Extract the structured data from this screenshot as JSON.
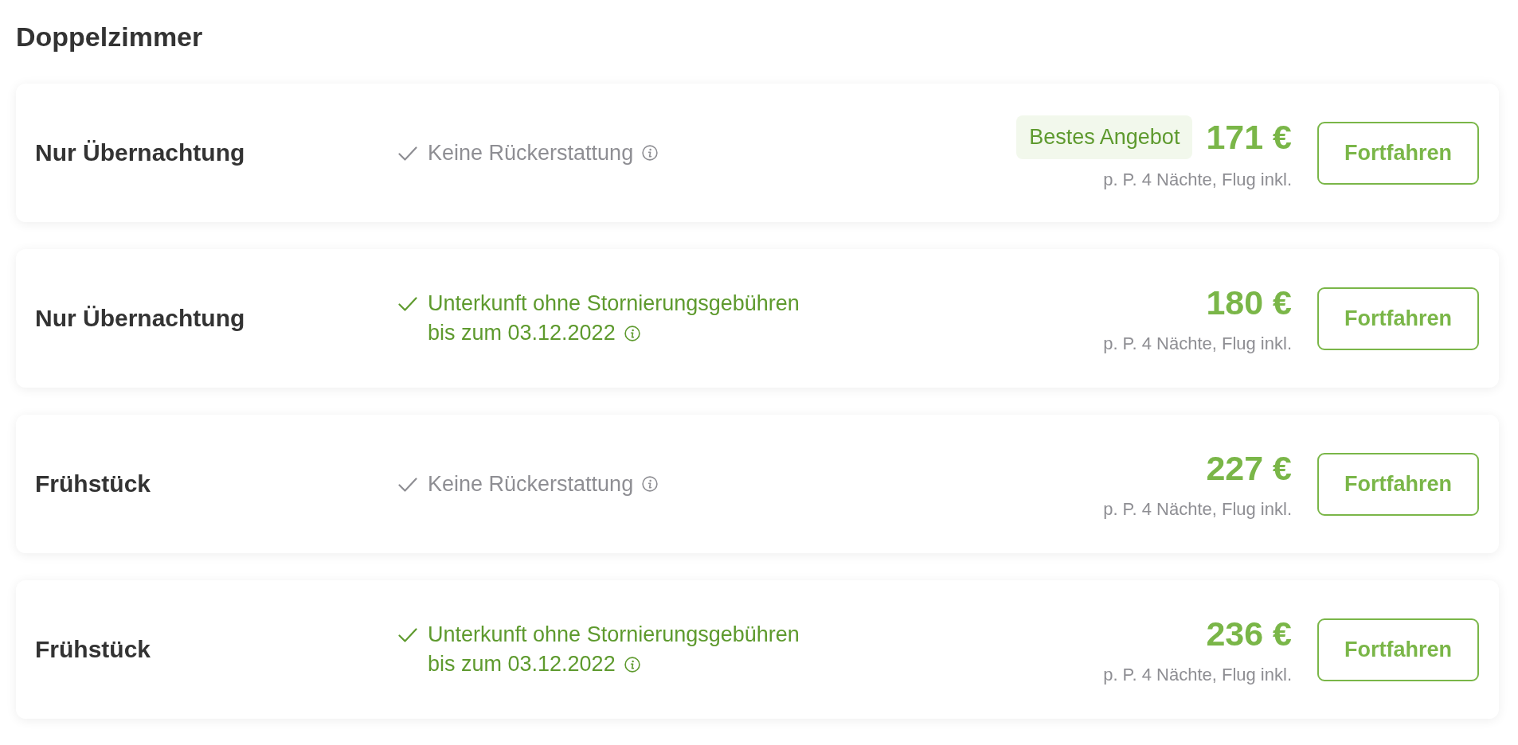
{
  "section": {
    "title": "Doppelzimmer"
  },
  "offers": [
    {
      "board": "Nur Übernachtung",
      "policy": {
        "kind": "non_refundable",
        "lines": [
          "Keine Rückerstattung"
        ]
      },
      "badge": "Bestes Angebot",
      "price": "171 €",
      "price_note": "p. P. 4 Nächte, Flug inkl.",
      "button": "Fortfahren"
    },
    {
      "board": "Nur Übernachtung",
      "policy": {
        "kind": "free_cancellation",
        "lines": [
          "Unterkunft ohne Stornierungsgebühren",
          "bis zum 03.12.2022"
        ]
      },
      "price": "180 €",
      "price_note": "p. P. 4 Nächte, Flug inkl.",
      "button": "Fortfahren"
    },
    {
      "board": "Frühstück",
      "policy": {
        "kind": "non_refundable",
        "lines": [
          "Keine Rückerstattung"
        ]
      },
      "price": "227 €",
      "price_note": "p. P. 4 Nächte, Flug inkl.",
      "button": "Fortfahren"
    },
    {
      "board": "Frühstück",
      "policy": {
        "kind": "free_cancellation",
        "lines": [
          "Unterkunft ohne Stornierungsgebühren",
          "bis zum 03.12.2022"
        ]
      },
      "price": "236 €",
      "price_note": "p. P. 4 Nächte, Flug inkl.",
      "button": "Fortfahren"
    }
  ]
}
